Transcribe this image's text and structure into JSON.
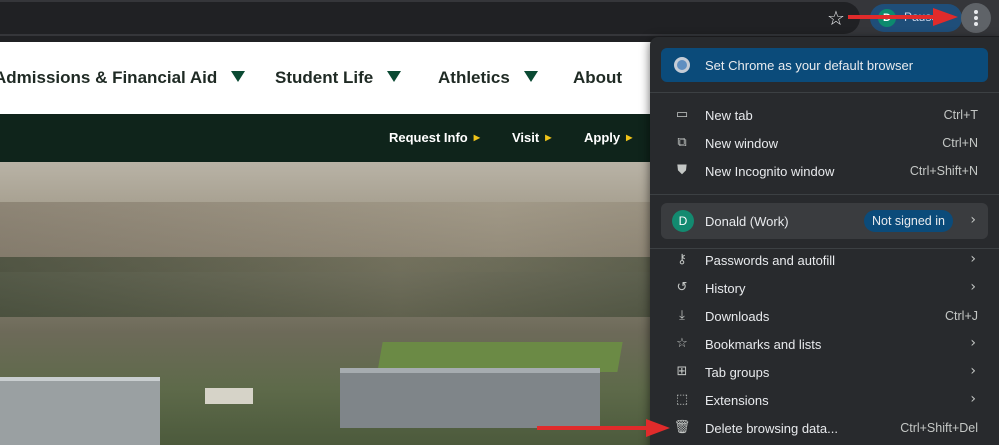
{
  "browser": {
    "profile_chip_initial": "D",
    "profile_chip_text": "Pause",
    "icons": {
      "bookmark": "star-icon",
      "menu": "kebab-menu-icon"
    }
  },
  "site": {
    "nav": [
      {
        "label": "Admissions & Financial Aid"
      },
      {
        "label": "Student Life"
      },
      {
        "label": "Athletics"
      },
      {
        "label": "About"
      }
    ],
    "bar_links": [
      {
        "label": "Request Info"
      },
      {
        "label": "Visit"
      },
      {
        "label": "Apply"
      }
    ]
  },
  "menu": {
    "promo_label": "Set Chrome as your default browser",
    "items_top": [
      {
        "label": "New tab",
        "shortcut": "Ctrl+T",
        "icon": "new-tab-icon"
      },
      {
        "label": "New window",
        "shortcut": "Ctrl+N",
        "icon": "new-window-icon"
      },
      {
        "label": "New Incognito window",
        "shortcut": "Ctrl+Shift+N",
        "icon": "incognito-icon"
      }
    ],
    "profile": {
      "initial": "D",
      "name": "Donald (Work)",
      "status": "Not signed in"
    },
    "items_bottom": [
      {
        "label": "Passwords and autofill",
        "icon": "key-icon",
        "shortcut": ""
      },
      {
        "label": "History",
        "icon": "history-icon",
        "shortcut": ""
      },
      {
        "label": "Downloads",
        "icon": "download-icon",
        "shortcut": "Ctrl+J"
      },
      {
        "label": "Bookmarks and lists",
        "icon": "star-icon",
        "shortcut": ""
      },
      {
        "label": "Tab groups",
        "icon": "tab-groups-icon",
        "shortcut": ""
      },
      {
        "label": "Extensions",
        "icon": "puzzle-icon",
        "shortcut": ""
      },
      {
        "label": "Delete browsing data...",
        "icon": "trash-icon",
        "shortcut": "Ctrl+Shift+Del"
      }
    ]
  },
  "colors": {
    "menu_bg": "#282a2d",
    "promo_bg": "#0b4b7a",
    "site_dark_green": "#0f241b",
    "nav_triangle": "#0b4a33",
    "annotation_arrow": "#e02b2b"
  }
}
